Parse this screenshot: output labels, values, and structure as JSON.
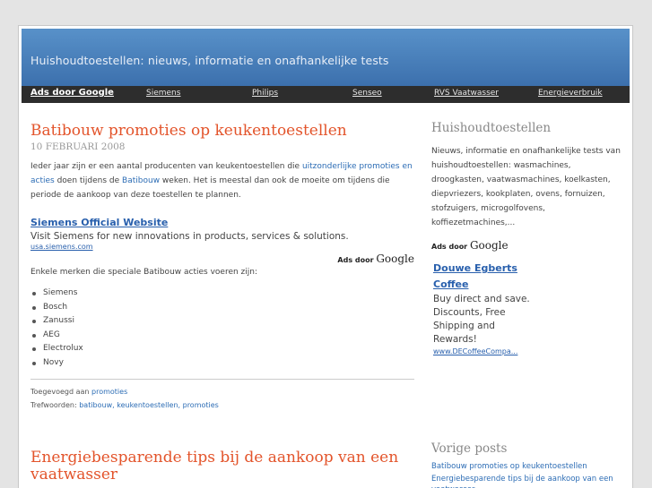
{
  "header": {
    "site_title": "Huishoudtoestellen: nieuws, informatie en onafhankelijke tests"
  },
  "nav": {
    "ads_label": "Ads door Google",
    "items": [
      "Siemens",
      "Philips",
      "Senseo",
      "RVS Vaatwasser",
      "Energieverbruik"
    ]
  },
  "post1": {
    "title": "Batibouw promoties op keukentoestellen",
    "date": "10 FEBRUARI 2008",
    "intro_a": "Ieder jaar zijn er een aantal producenten van keukentoestellen die ",
    "intro_link1": "uitzonderlijke promoties en acties",
    "intro_b": " doen tijdens de ",
    "intro_link2": "Batibouw",
    "intro_c": " weken. Het is meestal dan ook de moeite om tijdens die periode de aankoop van deze toestellen te plannen.",
    "ad": {
      "title": "Siemens Official Website",
      "desc": "Visit Siemens for new innovations in products, services & solutions.",
      "url": "usa.siemens.com"
    },
    "ads_badge_prefix": "Ads door",
    "ads_badge_brand": "Google",
    "brands_intro": "Enkele merken die speciale Batibouw acties voeren zijn:",
    "brands": [
      "Siemens",
      "Bosch",
      "Zanussi",
      "AEG",
      "Electrolux",
      "Novy"
    ],
    "added_label": "Toegevoegd aan ",
    "added_category": "promoties",
    "tags_label": "Trefwoorden: ",
    "tags": "batibouw, keukentoestellen, promoties"
  },
  "post2": {
    "title": "Energiebesparende tips bij de aankoop van een vaatwasser"
  },
  "sidebar": {
    "title": "Huishoudtoestellen",
    "description": "Nieuws, informatie en onafhankelijke tests van huishoudtoestellen: wasmachines, droogkasten, vaatwasmachines, koelkasten, diepvriezers, kookplaten, ovens, fornuizen, stofzuigers, microgolfovens, koffiezetmachines,...",
    "ads_badge_prefix": "Ads door",
    "ads_badge_brand": "Google",
    "ad": {
      "title_line1": "Douwe Egberts",
      "title_line2": "Coffee",
      "desc": "Buy direct and save. Discounts, Free Shipping and Rewards!",
      "url": "www.DECoffeeCompa..."
    },
    "previous_title": "Vorige posts",
    "previous": [
      "Batibouw promoties op keukentoestellen",
      "Energiebesparende tips bij de aankoop van een vaatwasser"
    ]
  }
}
